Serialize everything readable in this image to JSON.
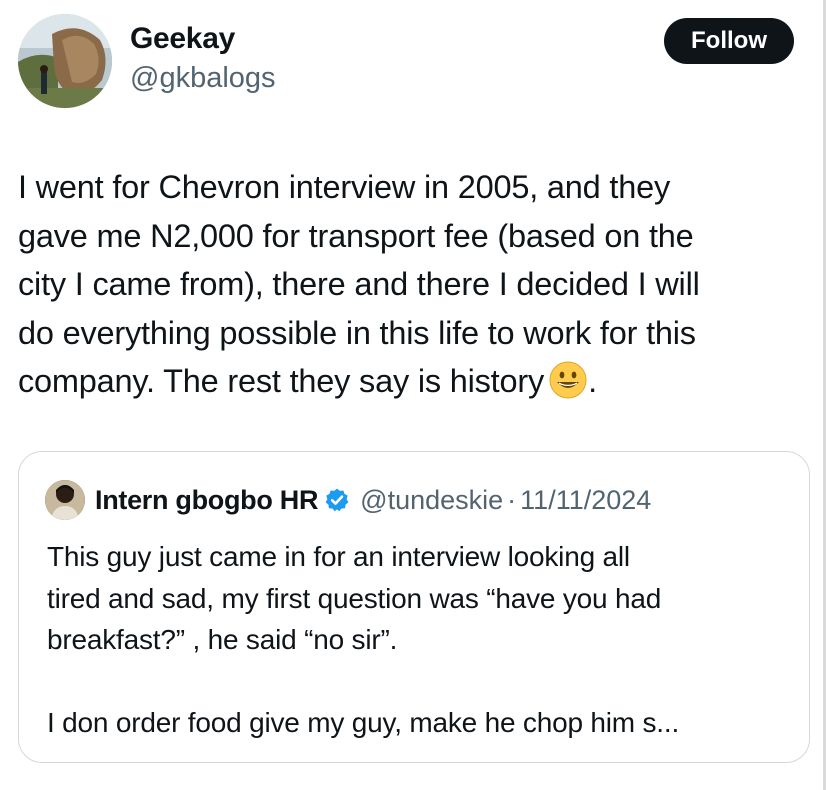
{
  "author": {
    "display_name": "Geekay",
    "handle": "@gkbalogs",
    "follow_label": "Follow"
  },
  "tweet": {
    "lines": [
      "I went for Chevron interview in 2005, and they",
      "gave me N2,000 for transport fee (based on the",
      "city I came from), there and there I decided I will",
      "do everything possible in this life to work for this",
      "company. The rest they say is history"
    ],
    "end_punct": ".",
    "emoji": "grinning-face-emoji"
  },
  "quoted_tweet": {
    "display_name": "Intern gbogbo HR",
    "verified_icon": "verified-badge-icon",
    "handle": "@tundeskie",
    "separator": "·",
    "date": "11/11/2024",
    "lines": [
      "This guy just came in for an interview looking all",
      "tired and sad, my first question was “have you had",
      "breakfast?” , he said “no sir”."
    ],
    "line_after_break": "I don order food give my guy, make he chop him s..."
  },
  "colors": {
    "text": "#0f1419",
    "secondary": "#536471",
    "border": "#cfd9de",
    "verified": "#1d9bf0",
    "follow_bg": "#0f1419"
  }
}
